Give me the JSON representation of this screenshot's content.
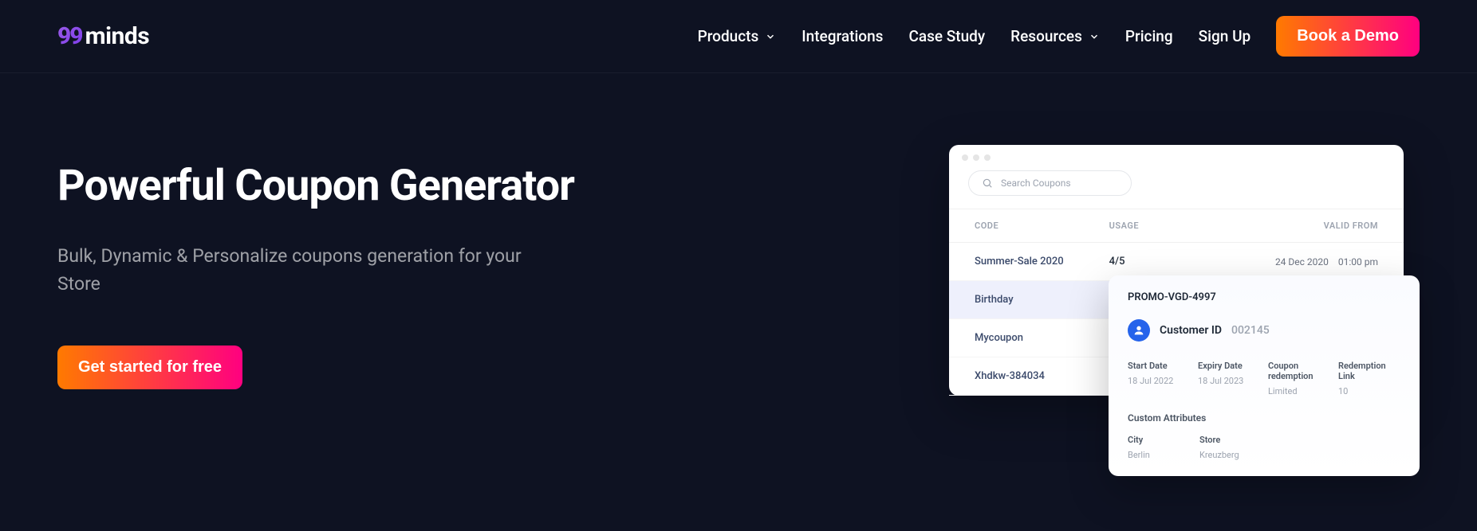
{
  "header": {
    "logo_mark": "99",
    "logo_text": "minds",
    "nav": [
      {
        "label": "Products",
        "has_chevron": true
      },
      {
        "label": "Integrations",
        "has_chevron": false
      },
      {
        "label": "Case Study",
        "has_chevron": false
      },
      {
        "label": "Resources",
        "has_chevron": true
      },
      {
        "label": "Pricing",
        "has_chevron": false
      },
      {
        "label": "Sign Up",
        "has_chevron": false
      }
    ],
    "demo_button": "Book a Demo"
  },
  "hero": {
    "title": "Powerful Coupon Generator",
    "subtitle": "Bulk, Dynamic & Personalize coupons generation for your Store",
    "cta": "Get started for free"
  },
  "app": {
    "search_placeholder": "Search Coupons",
    "columns": {
      "code": "CODE",
      "usage": "USAGE",
      "valid": "VALID FROM"
    },
    "rows": [
      {
        "code": "Summer-Sale 2020",
        "usage": "4/5",
        "date": "24 Dec 2020",
        "time": "01:00 pm",
        "highlight": false
      },
      {
        "code": "Birthday",
        "usage": "",
        "date": "",
        "time": "",
        "highlight": true
      },
      {
        "code": "Mycoupon",
        "usage": "",
        "date": "",
        "time": "",
        "highlight": false
      },
      {
        "code": "Xhdkw-384034",
        "usage": "",
        "date": "",
        "time": "",
        "highlight": false
      }
    ]
  },
  "detail": {
    "promo": "PROMO-VGD-4997",
    "customer_label": "Customer ID",
    "customer_id": "002145",
    "fields": [
      {
        "label": "Start Date",
        "value": "18 Jul 2022"
      },
      {
        "label": "Expiry Date",
        "value": "18 Jul 2023"
      },
      {
        "label": "Coupon redemption",
        "value": "Limited"
      },
      {
        "label": "Redemption Link",
        "value": "10"
      }
    ],
    "custom_title": "Custom Attributes",
    "attrs": [
      {
        "label": "City",
        "value": "Berlin"
      },
      {
        "label": "Store",
        "value": "Kreuzberg"
      }
    ]
  }
}
